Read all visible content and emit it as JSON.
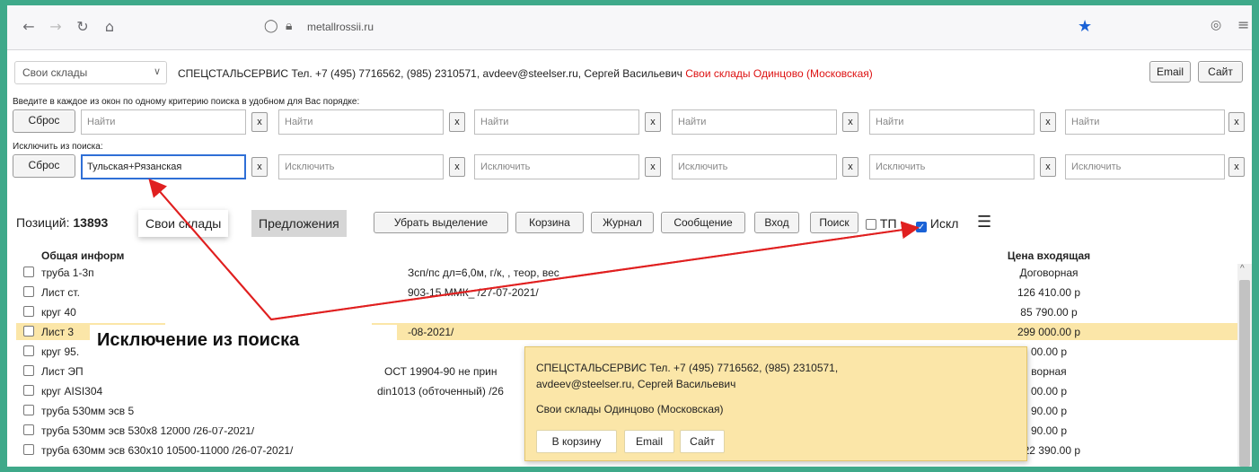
{
  "browser": {
    "url": "metallrossii.ru"
  },
  "supplier_bar": {
    "select_value": "Свои склады",
    "supplier_name": "СПЕЦСТАЛЬСЕРВИС",
    "contacts": "Тел. +7 (495) 7716562, (985) 2310571, avdeev@steelser.ru, Сергей Васильевич",
    "warehouse": "Свои склады Одинцово (Московская)",
    "email_label": "Email",
    "site_label": "Сайт"
  },
  "search": {
    "hint": "Введите в каждое из окон по одному критерию поиска в удобном для Вас порядке:",
    "reset_label": "Сброс",
    "placeholder": "Найти",
    "clear_label": "x"
  },
  "exclude": {
    "hint": "Исключить из поиска:",
    "reset_label": "Сброс",
    "first_value": "Тульская+Рязанская",
    "placeholder": "Исключить",
    "clear_label": "x"
  },
  "action_bar": {
    "positions_label": "Позиций:",
    "positions_count": "13893",
    "tab_own": "Свои склады",
    "tab_offers": "Предложения",
    "btn_clear_selection": "Убрать выделение",
    "btn_cart": "Корзина",
    "btn_journal": "Журнал",
    "btn_message": "Сообщение",
    "btn_login": "Вход",
    "btn_search": "Поиск",
    "cb_tp": "ТП",
    "cb_excl": "Искл"
  },
  "table": {
    "col_info": "Общая информ",
    "col_price": "Цена входящая",
    "rows": [
      {
        "name": "труба 1-3п",
        "name_tail": "Зсп/пс дл=6,0м, г/к, , теор, вес",
        "price": "Договорная"
      },
      {
        "name": "Лист ст.",
        "name_tail": "903-15 ММК_ /27-07-2021/",
        "price": "126 410.00 р"
      },
      {
        "name": "круг 40",
        "name_tail": "",
        "price": "85 790.00 р"
      },
      {
        "name": "Лист 3",
        "name_tail": "-08-2021/",
        "price": "299 000.00 р"
      },
      {
        "name": "круг 95.",
        "name_tail": "",
        "price": "00.00 р"
      },
      {
        "name": "Лист ЭП",
        "name_tail": "ОСТ 19904-90 не прин",
        "price": "ворная"
      },
      {
        "name": "круг AISI304",
        "name_tail": "din1013 (обточенный) /26",
        "price": "00.00 р"
      },
      {
        "name": "труба 530мм эсв 5",
        "name_tail": "",
        "price": "90.00 р"
      },
      {
        "name": "труба 530мм эсв 530х8 12000 /26-07-2021/",
        "name_tail": "",
        "price": "90.00 р"
      },
      {
        "name": "труба 630мм эсв 630х10 10500-11000 /26-07-2021/",
        "name_tail": "",
        "price": "122 390.00 р"
      }
    ]
  },
  "annotation": {
    "text": "Исключение из поиска"
  },
  "popup": {
    "line1": "СПЕЦСТАЛЬСЕРВИС   Тел. +7 (495) 7716562, (985) 2310571,",
    "line2": "avdeev@steelser.ru, Сергей Васильевич",
    "line3": "Свои склады Одинцово (Московская)",
    "btn_cart": "В корзину",
    "btn_email": "Email",
    "btn_site": "Сайт"
  },
  "colors": {
    "background": "#3fa98a",
    "highlight_row": "#fbe6a8",
    "accent_red": "#d11111",
    "accent_blue": "#1a62d6"
  }
}
